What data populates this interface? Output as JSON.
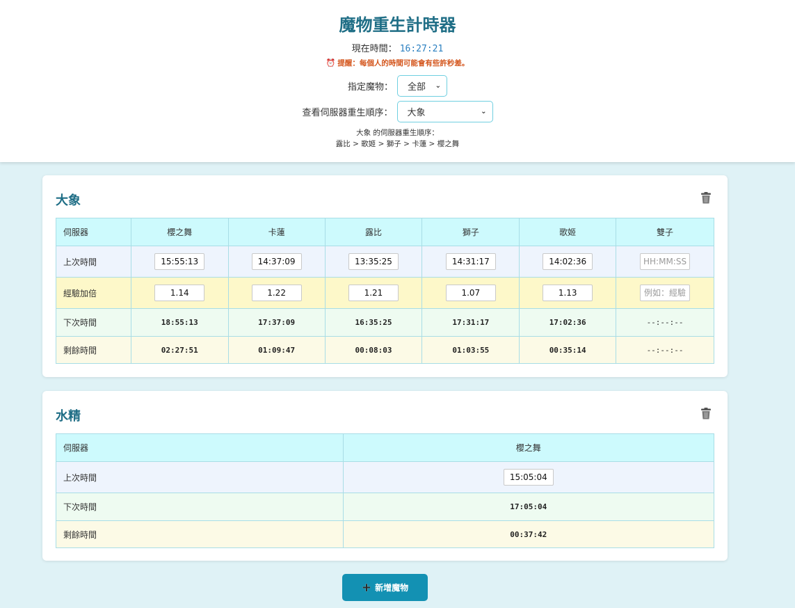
{
  "header": {
    "title": "魔物重生計時器",
    "now_label": "現在時間：",
    "now_time": "16:27:21",
    "warning": "提醒：每個人的時間可能會有些許秒差。",
    "monster_select_label": "指定魔物：",
    "monster_select_value": "全部",
    "order_select_label": "查看伺服器重生順序：",
    "order_select_value": "大象",
    "order_title": "大象 的伺服器重生順序：",
    "order_list": "露比 > 歌姬 > 獅子 > 卡蓮 > 櫻之舞"
  },
  "labels": {
    "server": "伺服器",
    "last_time": "上次時間",
    "multiplier": "經驗加倍",
    "next_time": "下次時間",
    "remaining": "剩餘時間"
  },
  "placeholders": {
    "time": "HH:MM:SS",
    "multiplier": "例如：經驗"
  },
  "monsters": [
    {
      "name": "大象",
      "servers": [
        {
          "name": "櫻之舞",
          "last": "15:55:13",
          "mult": "1.14",
          "next": "18:55:13",
          "remain": "02:27:51"
        },
        {
          "name": "卡蓮",
          "last": "14:37:09",
          "mult": "1.22",
          "next": "17:37:09",
          "remain": "01:09:47"
        },
        {
          "name": "露比",
          "last": "13:35:25",
          "mult": "1.21",
          "next": "16:35:25",
          "remain": "00:08:03"
        },
        {
          "name": "獅子",
          "last": "14:31:17",
          "mult": "1.07",
          "next": "17:31:17",
          "remain": "01:03:55"
        },
        {
          "name": "歌姬",
          "last": "14:02:36",
          "mult": "1.13",
          "next": "17:02:36",
          "remain": "00:35:14"
        },
        {
          "name": "雙子",
          "last": "",
          "mult": "",
          "next": "--:--:--",
          "remain": "--:--:--"
        }
      ]
    },
    {
      "name": "水精",
      "servers": [
        {
          "name": "櫻之舞",
          "last": "15:05:04",
          "next": "17:05:04",
          "remain": "00:37:42"
        }
      ]
    }
  ],
  "add_button": "新增魔物",
  "icons": {
    "alarm": "alarm-clock-icon",
    "trash": "trash-icon",
    "plus": "plus-icon",
    "chevron": "chevron-down-icon"
  }
}
